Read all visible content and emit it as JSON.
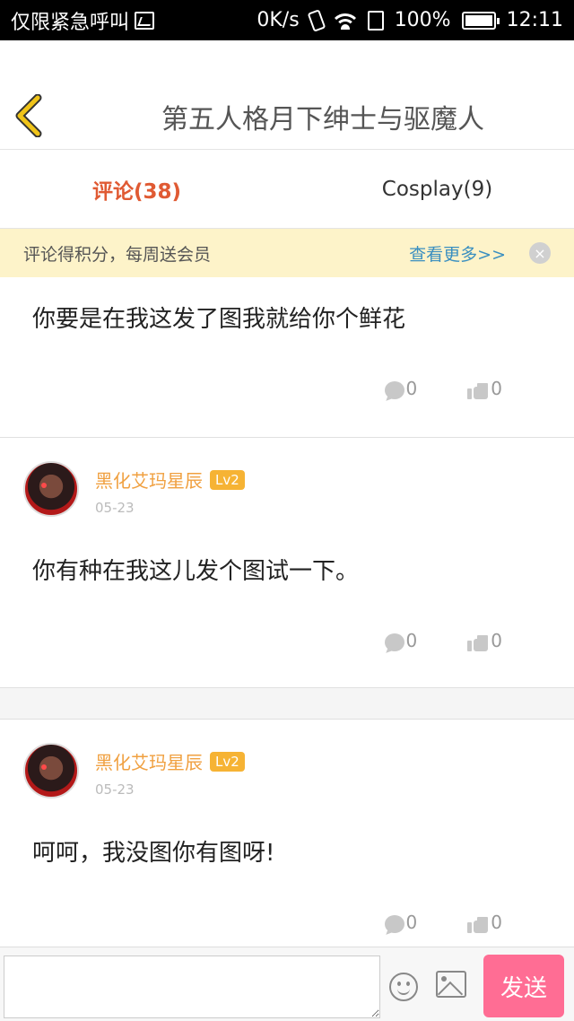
{
  "status_bar": {
    "carrier": "仅限紧急呼叫",
    "speed": "0K/s",
    "battery": "100%",
    "time": "12:11",
    "icons": [
      "gallery-icon",
      "vibrate-icon",
      "wifi-icon",
      "sim-icon",
      "battery-icon"
    ]
  },
  "header": {
    "title": "第五人格月下绅士与驱魔人",
    "back_icon": "chevron-left-icon",
    "back_color": "#f0c419"
  },
  "tabs": [
    {
      "label": "评论(38)",
      "active": true
    },
    {
      "label": "Cosplay(9)",
      "active": false
    }
  ],
  "notice": {
    "text": "评论得积分，每周送会员",
    "more": "查看更多>>",
    "close": "×"
  },
  "comments": [
    {
      "text": "你要是在我这发了图我就给你个鲜花",
      "reply_count": "0",
      "like_count": "0"
    },
    {
      "user": "黑化艾玛星辰",
      "level": "Lv2",
      "date": "05-23",
      "text": "你有种在我这儿发个图试一下。",
      "reply_count": "0",
      "like_count": "0"
    },
    {
      "user": "黑化艾玛星辰",
      "level": "Lv2",
      "date": "05-23",
      "text": "呵呵，我没图你有图呀!",
      "reply_count": "0",
      "like_count": "0"
    }
  ],
  "composer": {
    "input_value": "",
    "send_label": "发送"
  },
  "colors": {
    "active_tab": "#e05a33",
    "username": "#f0a040",
    "level_badge": "#f6b334",
    "notice_bg": "#fdf3c9",
    "link": "#3a8fc0",
    "send_button": "#ff6d94"
  }
}
